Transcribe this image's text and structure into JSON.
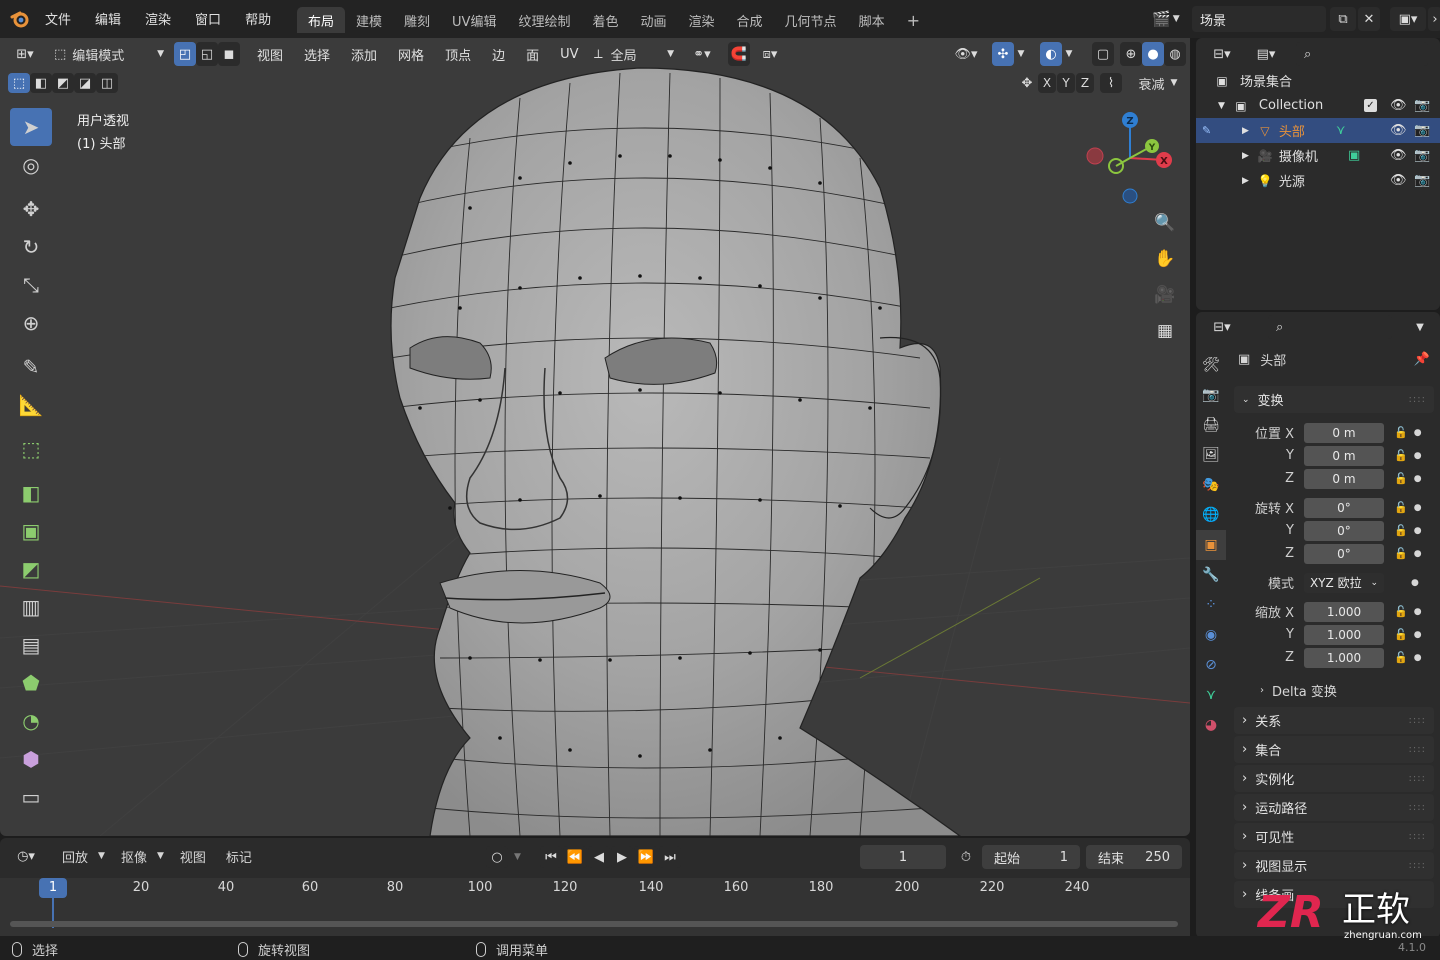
{
  "topbar": {
    "menu": [
      "文件",
      "编辑",
      "渲染",
      "窗口",
      "帮助"
    ],
    "workspaces": [
      "布局",
      "建模",
      "雕刻",
      "UV编辑",
      "纹理绘制",
      "着色",
      "动画",
      "渲染",
      "合成",
      "几何节点",
      "脚本"
    ],
    "active_workspace": 0,
    "add_tab": "+",
    "scene_name": "场景"
  },
  "viewport_header": {
    "mode": "编辑模式",
    "menus": [
      "视图",
      "选择",
      "添加",
      "网格",
      "顶点",
      "边",
      "面",
      "UV"
    ],
    "transform_orientation": "全局",
    "axes": [
      "X",
      "Y",
      "Z"
    ],
    "falloff": "衰减"
  },
  "viewport": {
    "view_name": "用户透视",
    "object_label": "(1) 头部",
    "gizmo": {
      "z": "Z",
      "y": "Y",
      "x": "X"
    }
  },
  "outliner": {
    "root": "场景集合",
    "collection": "Collection",
    "items": [
      {
        "name": "头部",
        "selected": true
      },
      {
        "name": "摄像机",
        "selected": false
      },
      {
        "name": "光源",
        "selected": false
      }
    ]
  },
  "properties": {
    "object_name": "头部",
    "transform_title": "变换",
    "location_label": "位置",
    "rotation_label": "旋转",
    "scale_label": "缩放",
    "axis_x": "X",
    "axis_y": "Y",
    "axis_z": "Z",
    "location": [
      "0 m",
      "0 m",
      "0 m"
    ],
    "rotation": [
      "0°",
      "0°",
      "0°"
    ],
    "mode_label": "模式",
    "mode_value": "XYZ 欧拉",
    "scale": [
      "1.000",
      "1.000",
      "1.000"
    ],
    "delta": "Delta 变换",
    "panels": [
      "关系",
      "集合",
      "实例化",
      "运动路径",
      "可见性",
      "视图显示",
      "线条画"
    ]
  },
  "timeline": {
    "menus": [
      "回放",
      "抠像",
      "视图",
      "标记"
    ],
    "current_frame": "1",
    "start_label": "起始",
    "start_value": "1",
    "end_label": "结束",
    "end_value": "250",
    "ticks": [
      "20",
      "40",
      "60",
      "80",
      "100",
      "120",
      "140",
      "160",
      "180",
      "200",
      "220",
      "240"
    ],
    "playhead": "1"
  },
  "statusbar": {
    "left": "选择",
    "middle": "旋转视图",
    "right": "调用菜单",
    "version": "4.1.0"
  },
  "watermark": {
    "brand": "ZR",
    "text": "正软",
    "url": "zhengruan.com"
  },
  "colors": {
    "accent": "#4772b3",
    "selected_row": "#334d80",
    "orange": "#e8923a",
    "gizmo_x": "#e03c4b",
    "gizmo_y": "#8cc63f",
    "gizmo_z": "#2f7fd3"
  }
}
